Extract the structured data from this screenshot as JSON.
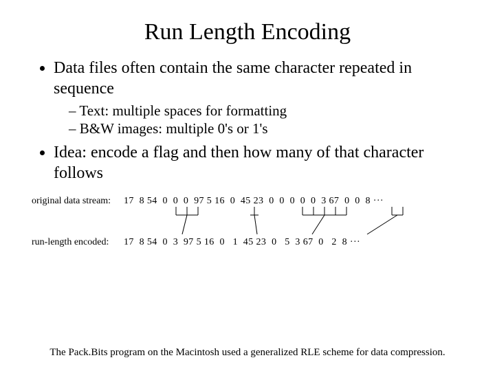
{
  "title": "Run Length Encoding",
  "bullets": {
    "b1": "Data files often contain the same character repeated in sequence",
    "b1a": "Text: multiple spaces for formatting",
    "b1b": "B&W images: multiple 0's or 1's",
    "b2": "Idea: encode a flag and then how many of that character follows"
  },
  "diagram": {
    "label_original": "original data stream:",
    "label_encoded": "run-length encoded:",
    "original_values": [
      17,
      8,
      54,
      0,
      0,
      0,
      97,
      5,
      16,
      0,
      45,
      23,
      0,
      0,
      0,
      0,
      0,
      3,
      67,
      0,
      0,
      8
    ],
    "encoded_values": [
      17,
      8,
      54,
      0,
      3,
      97,
      5,
      16,
      0,
      1,
      45,
      23,
      0,
      5,
      3,
      67,
      0,
      2,
      8
    ],
    "original_text": "17  8 54  0  0  0  97 5 16  0  45 23  0  0  0  0  0  3 67  0  0  8 ···",
    "encoded_text": "17  8 54  0  3  97 5 16  0   1  45 23  0   5  3 67  0   2  8 ···"
  },
  "footer": "The Pack.Bits program on the Macintosh used a generalized RLE scheme for data compression."
}
